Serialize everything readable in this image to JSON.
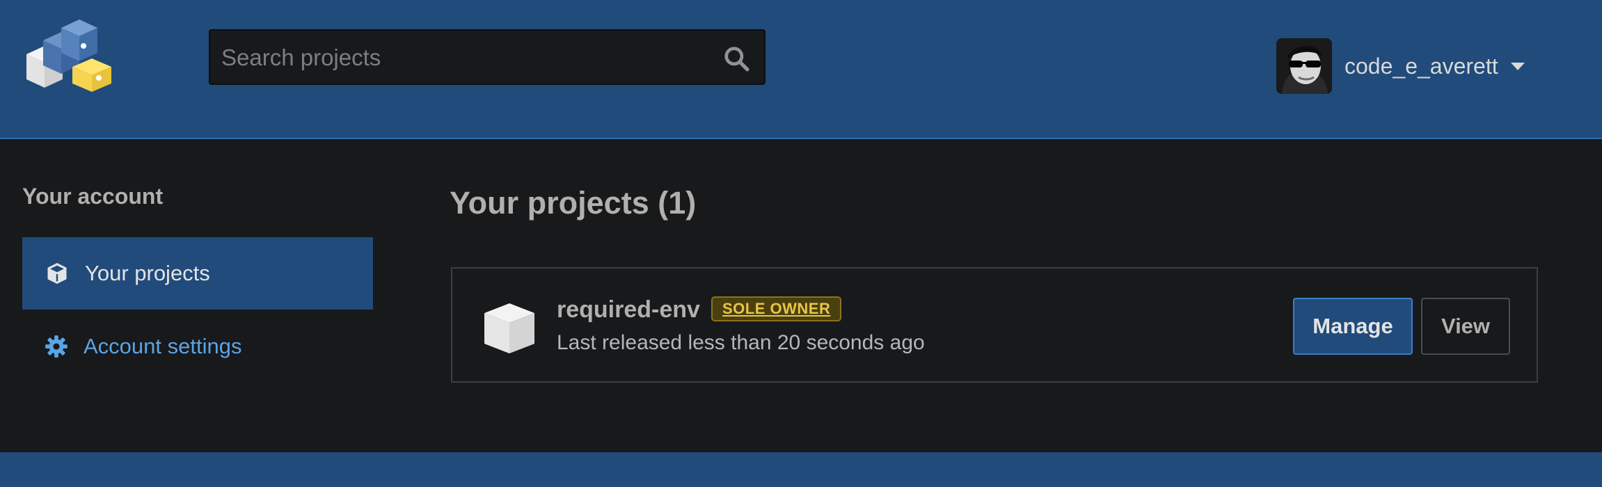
{
  "header": {
    "search": {
      "placeholder": "Search projects"
    },
    "user": {
      "username": "code_e_averett"
    }
  },
  "sidebar": {
    "heading": "Your account",
    "items": [
      {
        "label": "Your projects",
        "icon": "box-icon",
        "active": true
      },
      {
        "label": "Account settings",
        "icon": "gear-icon",
        "active": false
      }
    ]
  },
  "main": {
    "title": "Your projects (1)",
    "projects": [
      {
        "name": "required-env",
        "badge": "SOLE OWNER",
        "meta": "Last released less than 20 seconds ago",
        "actions": {
          "manage": "Manage",
          "view": "View"
        }
      }
    ]
  },
  "colors": {
    "header_bg": "#214b7a",
    "page_bg": "#18191b",
    "link": "#5aa4e6",
    "badge": "#e8c547"
  }
}
